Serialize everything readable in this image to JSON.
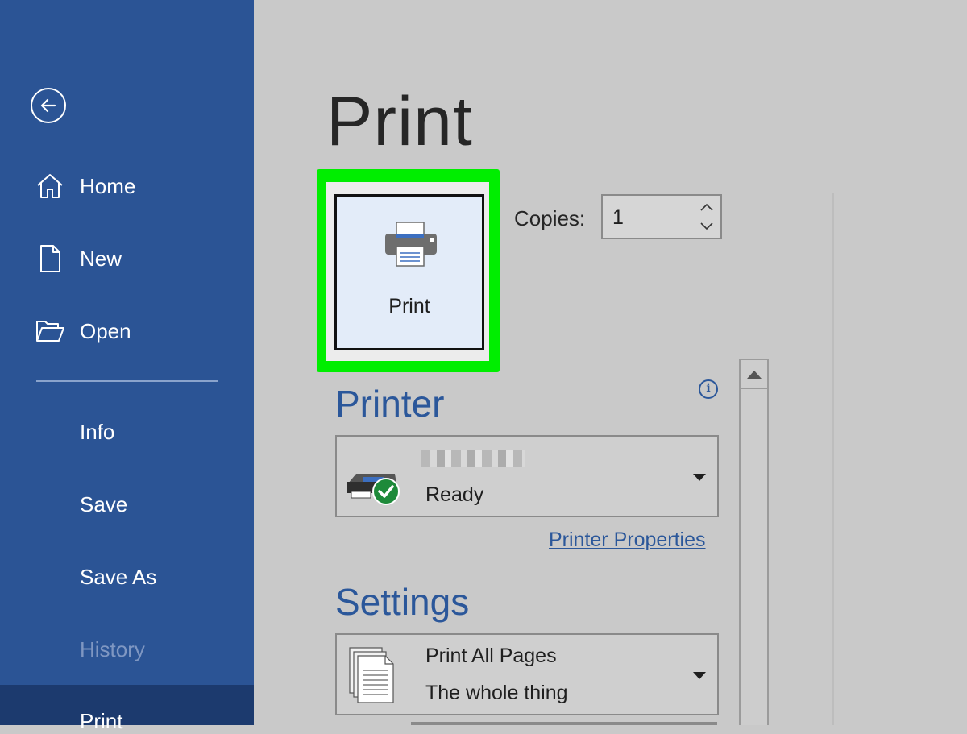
{
  "sidebar": {
    "back_icon": "back-arrow-icon",
    "items": [
      {
        "label": "Home",
        "icon": "home-icon"
      },
      {
        "label": "New",
        "icon": "new-document-icon"
      },
      {
        "label": "Open",
        "icon": "open-folder-icon"
      },
      {
        "label": "Info"
      },
      {
        "label": "Save"
      },
      {
        "label": "Save As"
      },
      {
        "label": "History",
        "disabled": true
      },
      {
        "label": "Print",
        "selected": true
      }
    ],
    "colors": {
      "background": "#2b5495",
      "selected": "#1c3a6e",
      "disabled_text": "#7f97c2"
    }
  },
  "main": {
    "title": "Print",
    "print_button": {
      "label": "Print",
      "icon": "printer-icon",
      "highlight_color": "#00ee00"
    },
    "copies": {
      "label": "Copies:",
      "value": "1"
    },
    "printer_section": {
      "heading": "Printer",
      "info_icon": "info-icon",
      "selected_printer": {
        "status": "Ready",
        "icon": "printer-ready-icon"
      },
      "properties_link": "Printer Properties"
    },
    "settings_section": {
      "heading": "Settings",
      "pages_setting": {
        "title": "Print All Pages",
        "description": "The whole thing",
        "icon": "pages-icon"
      }
    },
    "accent_color": "#2b579a"
  }
}
